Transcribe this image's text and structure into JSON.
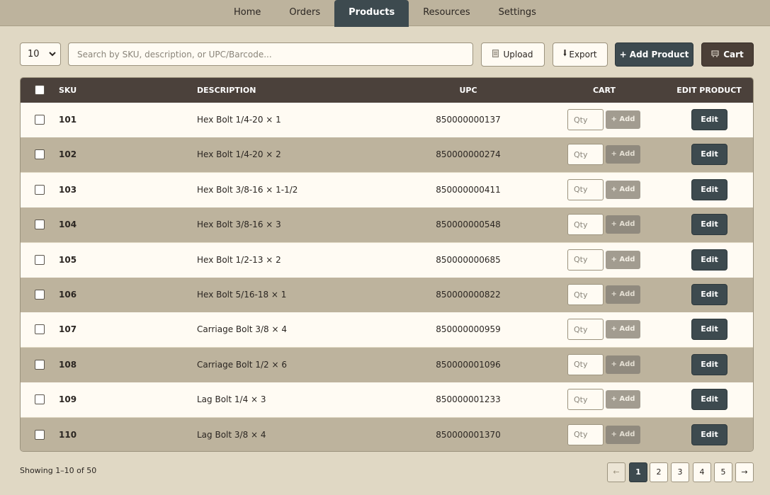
{
  "nav": {
    "tabs": [
      {
        "label": "Home"
      },
      {
        "label": "Orders"
      },
      {
        "label": "Products"
      },
      {
        "label": "Resources"
      },
      {
        "label": "Settings"
      }
    ],
    "active": "Products"
  },
  "toolbar": {
    "page_size": "10",
    "search_placeholder": "Search by SKU, description, or UPC/Barcode...",
    "upload_label": "Upload",
    "export_label": "Export",
    "add_product_label": "+ Add Product",
    "cart_label": "Cart"
  },
  "table": {
    "headers": {
      "sku": "SKU",
      "description": "DESCRIPTION",
      "upc": "UPC",
      "cart": "CART",
      "edit": "EDIT PRODUCT"
    },
    "qty_placeholder": "Qty",
    "add_label": "+ Add",
    "edit_label": "Edit",
    "rows": [
      {
        "sku": "101",
        "description": "Hex Bolt 1/4-20 × 1",
        "upc": "850000000137"
      },
      {
        "sku": "102",
        "description": "Hex Bolt 1/4-20 × 2",
        "upc": "850000000274"
      },
      {
        "sku": "103",
        "description": "Hex Bolt 3/8-16 × 1-1/2",
        "upc": "850000000411"
      },
      {
        "sku": "104",
        "description": "Hex Bolt 3/8-16 × 3",
        "upc": "850000000548"
      },
      {
        "sku": "105",
        "description": "Hex Bolt 1/2-13 × 2",
        "upc": "850000000685"
      },
      {
        "sku": "106",
        "description": "Hex Bolt 5/16-18 × 1",
        "upc": "850000000822"
      },
      {
        "sku": "107",
        "description": "Carriage Bolt 3/8 × 4",
        "upc": "850000000959"
      },
      {
        "sku": "108",
        "description": "Carriage Bolt 1/2 × 6",
        "upc": "850000001096"
      },
      {
        "sku": "109",
        "description": "Lag Bolt 1/4 × 3",
        "upc": "850000001233"
      },
      {
        "sku": "110",
        "description": "Lag Bolt 3/8 × 4",
        "upc": "850000001370"
      }
    ]
  },
  "footer": {
    "showing": "Showing 1–10 of 50",
    "prev": "←",
    "next": "→",
    "pages": [
      "1",
      "2",
      "3",
      "4",
      "5"
    ],
    "current_page": "1"
  },
  "icons": {
    "upload": "document-icon",
    "export": "download-icon",
    "cart": "cart-icon",
    "page_size": "chevron-down-icon"
  },
  "colors": {
    "background": "#e0d8c4",
    "nav": "#bdb39d",
    "accent": "#3d4a4f",
    "header": "#4b413b",
    "row_alt": "#bdb39d",
    "row": "#fffbf3"
  }
}
